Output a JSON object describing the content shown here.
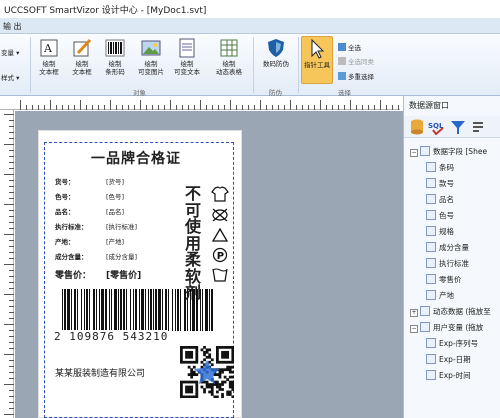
{
  "window": {
    "title": "UCCSOFT SmartVizor 设计中心 - [MyDoc1.svt]"
  },
  "menu": {
    "item": "输 出"
  },
  "ribbon": {
    "left_cut": [
      "变量",
      "样式"
    ],
    "buttons": [
      {
        "label": "绘制\n文本框"
      },
      {
        "label": "绘制\n文本框"
      },
      {
        "label": "绘制\n条形码"
      },
      {
        "label": "绘制\n可变图片"
      },
      {
        "label": "绘制\n可变文本"
      },
      {
        "label": "绘制\n动态表格"
      },
      {
        "label": "数码防伪"
      },
      {
        "label": "指针工具"
      }
    ],
    "select_items": [
      "全选",
      "全选同类",
      "多重选择"
    ],
    "groups": [
      "对象",
      "防伪",
      "选择"
    ],
    "accent": "#f7c65a"
  },
  "document": {
    "title": "一品牌合格证",
    "fields": [
      {
        "label": "货号：",
        "value": "[货号]"
      },
      {
        "label": "色号：",
        "value": "[色号]"
      },
      {
        "label": "品名：",
        "value": "[品名]"
      },
      {
        "label": "执行标准：",
        "value": "[执行标准]"
      },
      {
        "label": "产地：",
        "value": "[产地]"
      },
      {
        "label": "成分含量：",
        "value": "[成分含量]"
      }
    ],
    "price_label": "零售价：",
    "price_value": "[零售价]",
    "vertical_text": "不可使用柔软剂",
    "care_symbols": [
      "shirt-icon",
      "no-bleach-icon",
      "triangle-icon",
      "p-circle-icon",
      "wash-icon"
    ],
    "barcode_digits": "2  109876  543210",
    "company": "某某服装制造有限公司"
  },
  "panel": {
    "title": "数据源窗口",
    "tree": [
      {
        "level": 0,
        "label": "数据字段 [Shee"
      },
      {
        "level": 1,
        "label": "条码"
      },
      {
        "level": 1,
        "label": "款号"
      },
      {
        "level": 1,
        "label": "品名"
      },
      {
        "level": 1,
        "label": "色号"
      },
      {
        "level": 1,
        "label": "规格"
      },
      {
        "level": 1,
        "label": "成分含量"
      },
      {
        "level": 1,
        "label": "执行标准"
      },
      {
        "level": 1,
        "label": "零售价"
      },
      {
        "level": 1,
        "label": "产地"
      },
      {
        "level": 0,
        "label": "动态数据 (拖放至"
      },
      {
        "level": 0,
        "label": "用户变量 (拖放"
      },
      {
        "level": 1,
        "label": "Exp-序列号"
      },
      {
        "level": 1,
        "label": "Exp-日期"
      },
      {
        "level": 1,
        "label": "Exp-时间"
      }
    ]
  }
}
